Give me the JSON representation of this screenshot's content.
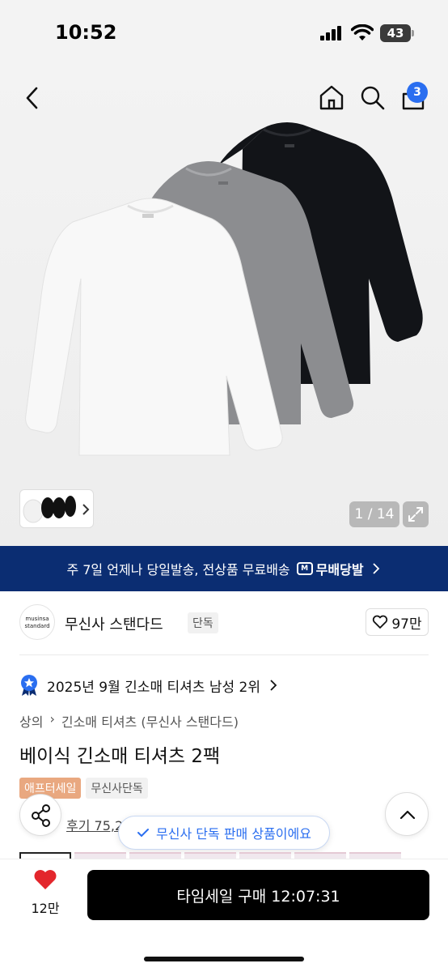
{
  "status": {
    "time": "10:52",
    "battery": "43"
  },
  "header": {
    "cart_count": "3"
  },
  "gallery": {
    "counter": "1 / 14"
  },
  "shipping_banner": {
    "text": "주 7일 언제나 당일발송, 전상품 무료배송",
    "logo_text": "무배당발"
  },
  "brand": {
    "logo_line1": "musinsa",
    "logo_line2": "standard",
    "name": "무신사 스탠다드",
    "tag": "단독",
    "likes": "97만"
  },
  "ranking": {
    "text": "2025년 9월 긴소매 티셔츠 남성 2위"
  },
  "breadcrumb": [
    "상의",
    "긴소매 티셔츠 (무신사 스탠다드)"
  ],
  "product": {
    "title": "베이식 긴소매 티셔츠 2팩",
    "badge_sale": "애프터세일",
    "badge_exclusive": "무신사단독",
    "review_text": "후기 75,2"
  },
  "toast": {
    "text": "무신사 단독 판매 상품이에요"
  },
  "bottom_bar": {
    "likes": "12만",
    "buy_label": "타임세일 구매 12:07:31"
  },
  "colors": {
    "banner_bg": "#0b2d72",
    "accent_blue": "#2a6ef0",
    "heart_red": "#e3262c",
    "sale_badge": "#e9a880",
    "buy_button": "#000000"
  },
  "icons": [
    "back-icon",
    "home-icon",
    "search-icon",
    "cart-icon",
    "expand-icon",
    "heart-icon",
    "share-icon",
    "chevron-up-icon",
    "check-icon",
    "ranking-badge-icon",
    "chevron-right-icon"
  ]
}
